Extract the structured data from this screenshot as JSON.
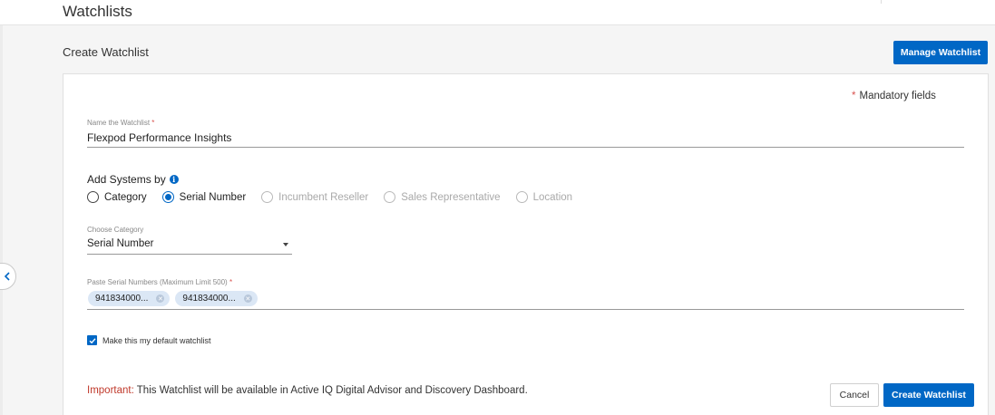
{
  "page": {
    "title": "Watchlists"
  },
  "section": {
    "title": "Create Watchlist",
    "manage_label": "Manage Watchlist"
  },
  "form": {
    "mandatory_text": "Mandatory fields",
    "name_label": "Name the Watchlist",
    "name_value": "Flexpod Performance Insights",
    "add_systems_label": "Add Systems by",
    "radio_options": [
      {
        "label": "Category",
        "checked": false,
        "disabled": false
      },
      {
        "label": "Serial Number",
        "checked": true,
        "disabled": false
      },
      {
        "label": "Incumbent Reseller",
        "checked": false,
        "disabled": true
      },
      {
        "label": "Sales Representative",
        "checked": false,
        "disabled": true
      },
      {
        "label": "Location",
        "checked": false,
        "disabled": true
      }
    ],
    "category_label": "Choose Category",
    "category_value": "Serial Number",
    "serials_label": "Paste Serial Numbers (Maximum Limit 500)",
    "serial_chips": [
      "941834000...",
      "941834000..."
    ],
    "default_checkbox_label": "Make this my default watchlist",
    "default_checked": true,
    "important_label": "Important:",
    "important_text": " This Watchlist will be available in Active IQ Digital Advisor and Discovery Dashboard."
  },
  "actions": {
    "cancel_label": "Cancel",
    "create_label": "Create Watchlist"
  },
  "icons": {
    "info": "info-icon",
    "collapse": "chevron-left-icon",
    "checkbox": "check-icon",
    "chip_remove": "close-icon",
    "dropdown": "caret-down-icon"
  },
  "colors": {
    "accent": "#0067c5",
    "required": "#d9534f",
    "important": "#c0392b",
    "chip": "#dbe7f5"
  }
}
